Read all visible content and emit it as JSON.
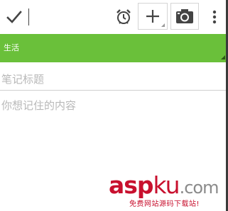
{
  "toolbar": {
    "done_icon": "check-icon",
    "alarm_icon": "alarm-clock-icon",
    "add_icon": "plus-icon",
    "camera_icon": "camera-icon",
    "menu_icon": "overflow-menu-icon"
  },
  "category": {
    "label": "生活",
    "color": "#6ac03a"
  },
  "note": {
    "title_placeholder": "笔记标题",
    "content_placeholder": "你想记住的内容"
  },
  "watermark": {
    "brand_a": "asp",
    "brand_b": "ku",
    "brand_c": ".com",
    "tagline": "免费网站源码下载站!"
  }
}
